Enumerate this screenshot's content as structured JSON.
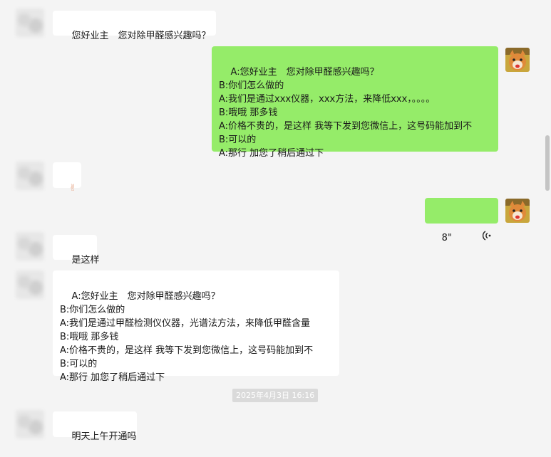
{
  "messages": {
    "m1": "您好业主　您对除甲醛感兴趣吗？",
    "m2_lines": "A:您好业主　您对除甲醛感兴趣吗？\nB:你们怎么做的\nA:我们是通过xxx仪器，xxx方法，来降低xxx，。。。。\nB:哦哦 那多钱\nA:价格不贵的，是这样 我等下发到您微信上，这号码能加到不\nB:可以的\nA:那行 加您了稍后通过下",
    "m3_emoji": "✌",
    "m4_voice_duration": "8\"",
    "m5": "是这样",
    "m6_lines": "A:您好业主　您对除甲醛感兴趣吗？\nB:你们怎么做的\nA:我们是通过甲醛检测仪仪器，光谱法方法，来降低甲醛含量\nB:哦哦 那多钱\nA:价格不贵的，是这样 我等下发到您微信上，这号码能加到不\nB:可以的\nA:那行 加您了稍后通过下",
    "timestamp": "2025年4月3日 16:16",
    "m7": "明天上午开通吗"
  },
  "icons": {
    "voice": "voice-wave-icon",
    "self_avatar": "shiba-dog-avatar"
  },
  "colors": {
    "self_bubble": "#95ec69",
    "other_bubble": "#ffffff",
    "background": "#f4f4f4"
  }
}
